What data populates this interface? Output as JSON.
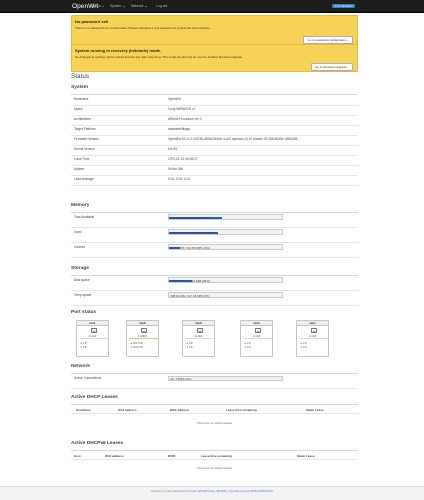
{
  "header": {
    "brand": "OpenWrt",
    "nav": [
      "Status",
      "System",
      "Network",
      "Log out"
    ],
    "refresh_badge": "AUTO REFRESH"
  },
  "alerts": [
    {
      "title": "No password set!",
      "text": "There is no password set on this router. Please configure a root password to protect the web interface.",
      "button": "Go to password configuration..."
    },
    {
      "title": "System running in recovery (initramfs) mode.",
      "text": "No changes to settings will be stored and are lost after rebooting. This mode should only be used to install a firmware upgrade",
      "button": "Go to firmware upgrade..."
    }
  ],
  "page_title": "Status",
  "system": {
    "heading": "System",
    "rows": [
      {
        "key": "Hostname",
        "value": "OpenWrt"
      },
      {
        "key": "Model",
        "value": "Cudy WR3000H v1"
      },
      {
        "key": "Architecture",
        "value": "ARMv8 Processor rev 4"
      },
      {
        "key": "Target Platform",
        "value": "mediatek/filogic"
      },
      {
        "key": "Firmware Version",
        "value": "OpenWrt 24.10.2 r28739-d9340319c6 / LuCI openwrt-24.10 branch 25.168.50434~d8b1286"
      },
      {
        "key": "Kernel Version",
        "value": "6.6.93"
      },
      {
        "key": "Local Time",
        "value": "1970-01-01 00:05:27"
      },
      {
        "key": "Uptime",
        "value": "0h 5m 28s"
      },
      {
        "key": "Load Average",
        "value": "0.01, 0.04, 0.01"
      }
    ]
  },
  "memory": {
    "heading": "Memory",
    "rows": [
      {
        "key": "Total Available",
        "value": "111.75 MiB / 234.69 MiB (47%)",
        "percent": 47
      },
      {
        "key": "Used",
        "value": "101.37 MiB / 234.69 MiB (43%)",
        "percent": 43
      },
      {
        "key": "Cached",
        "value": "28.77 MiB / 234.69 MiB (10%)",
        "percent": 10
      }
    ]
  },
  "storage": {
    "heading": "Storage",
    "rows": [
      {
        "key": "Disk space",
        "value": "24.57 MiB / 117.34 MiB (20%)",
        "percent": 20
      },
      {
        "key": "Temp space",
        "value": "208.00 KiB / 117.34 MiB (0%)",
        "percent": 0
      }
    ]
  },
  "port_status": {
    "heading": "Port status",
    "ports": [
      {
        "name": "lan1",
        "speed": "no link",
        "up": false,
        "tx": "0 B",
        "rx": "0 B"
      },
      {
        "name": "lan2",
        "speed": "1 Gbit/s",
        "up": true,
        "tx": "926.3 KB",
        "rx": "601.5 KB"
      },
      {
        "name": "lan3",
        "speed": "no link",
        "up": false,
        "tx": "0 B",
        "rx": "0 B"
      },
      {
        "name": "lan4",
        "speed": "no link",
        "up": false,
        "tx": "0 B",
        "rx": "0 B"
      },
      {
        "name": "wan",
        "speed": "no link",
        "up": false,
        "tx": "0 B",
        "rx": "0 B"
      }
    ]
  },
  "network": {
    "heading": "Network",
    "rows": [
      {
        "key": "Active Connections",
        "value": "20 / 15360 (0%)",
        "percent": 0
      }
    ]
  },
  "dhcp": {
    "heading": "Active DHCP Leases",
    "columns": [
      "Hostname",
      "IPv4 address",
      "MAC address",
      "Lease time remaining",
      "Static Lease"
    ],
    "empty": "There are no active leases"
  },
  "dhcpv6": {
    "heading": "Active DHCPv6 Leases",
    "columns": [
      "Host",
      "IPv6 address",
      "DUID",
      "Lease time remaining",
      "Static Lease"
    ],
    "empty": "There are no active leases"
  },
  "footer": {
    "prefix": "Powered by ",
    "luci": "LuCI openwrt-24.10 branch (25.168.50434~d8b1286)",
    "firmware": "OpenWrt 24.10.2 r28739-d9340319c6"
  }
}
